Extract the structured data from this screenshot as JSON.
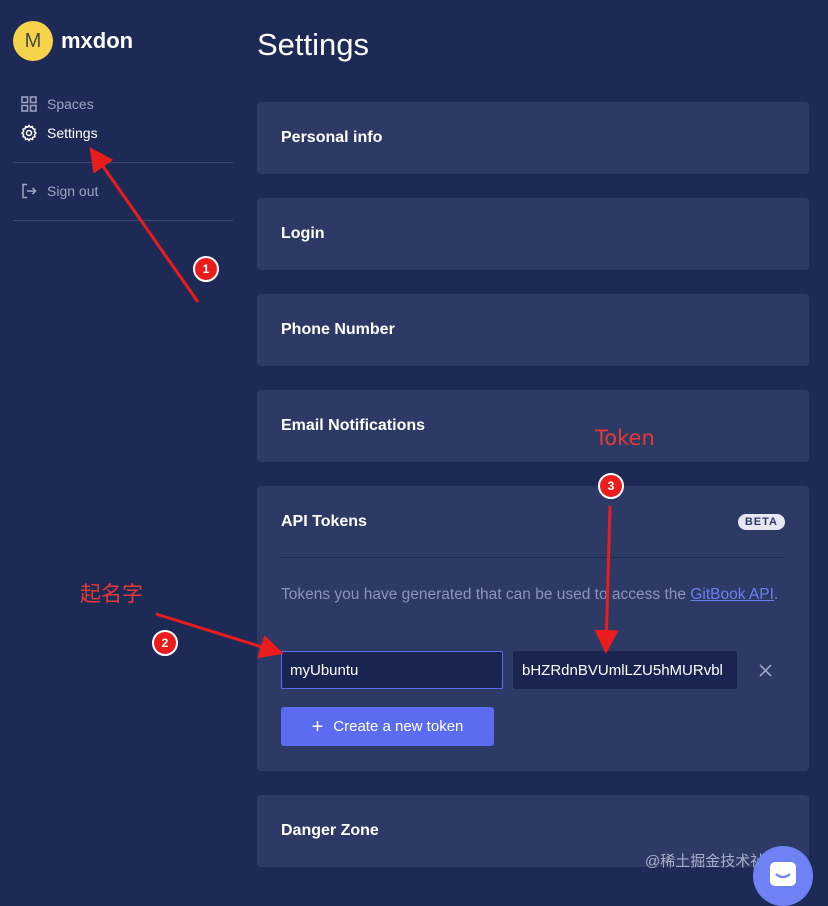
{
  "user": {
    "avatar_initial": "M",
    "name": "mxdon"
  },
  "sidebar": {
    "items": [
      {
        "label": "Spaces",
        "icon": "grid-icon"
      },
      {
        "label": "Settings",
        "icon": "gear-icon"
      },
      {
        "label": "Sign out",
        "icon": "sign-out-icon"
      }
    ]
  },
  "page": {
    "title": "Settings"
  },
  "sections": {
    "personal_info": "Personal info",
    "login": "Login",
    "phone_number": "Phone Number",
    "email_notifications": "Email Notifications",
    "api_tokens": {
      "title": "API Tokens",
      "badge": "BETA",
      "desc_text": "Tokens you have generated that can be used to access the ",
      "desc_link": "GitBook API",
      "desc_end": ".",
      "token_name_value": "myUbuntu",
      "token_value": "bHZRdnBVUmlLZU5hMURvbl",
      "create_button_label": "Create a new token"
    },
    "danger_zone": "Danger Zone"
  },
  "annotations": {
    "token_label": "Token",
    "name_label": "起名字",
    "markers": [
      "1",
      "2",
      "3"
    ]
  },
  "watermark": "@稀土掘金技术社区",
  "colors": {
    "background": "#1e2a56",
    "card": "#2d3a66",
    "accent": "#5b6cf0",
    "avatar": "#f5d44b",
    "annotation": "#e53935"
  }
}
